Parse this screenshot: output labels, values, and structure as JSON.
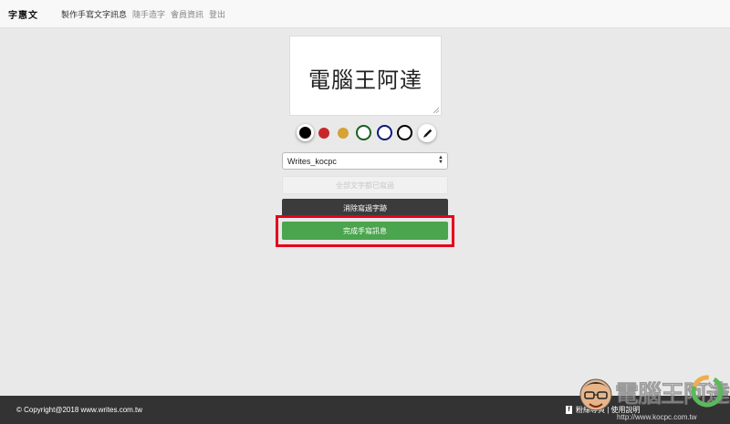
{
  "navbar": {
    "logo_text": "字惠文",
    "items": [
      {
        "label": "製作手寫文字訊息",
        "active": true
      },
      {
        "label": "隨手造字",
        "active": false
      },
      {
        "label": "會員資訊",
        "active": false
      },
      {
        "label": "登出",
        "active": false
      }
    ]
  },
  "canvas": {
    "handwritten_text": "電腦王阿達"
  },
  "colors": {
    "swatches": [
      {
        "name": "black",
        "hex": "#000000",
        "style": "filled-selected"
      },
      {
        "name": "red",
        "hex": "#c9262b",
        "style": "filled"
      },
      {
        "name": "gold",
        "hex": "#d4a335",
        "style": "filled"
      },
      {
        "name": "green",
        "hex": "#1b5e20",
        "style": "ring"
      },
      {
        "name": "navy",
        "hex": "#0d1a7a",
        "style": "ring"
      },
      {
        "name": "black-outline",
        "hex": "#000000",
        "style": "ring"
      }
    ],
    "pen_icon": "pen-icon"
  },
  "font_select": {
    "value": "Writes_kocpc"
  },
  "buttons": {
    "all_written": "全部文字都已寫過",
    "clear_strokes": "消除寫過字跡",
    "complete": "完成手寫訊息"
  },
  "highlight_color": "#e4001b",
  "footer": {
    "copyright": "© Copyright@2018 www.writes.com.tw",
    "links": "粉絲專頁  |  使用說明"
  },
  "watermark": {
    "text": "電腦王阿達",
    "url": "http://www.kocpc.com.tw"
  }
}
